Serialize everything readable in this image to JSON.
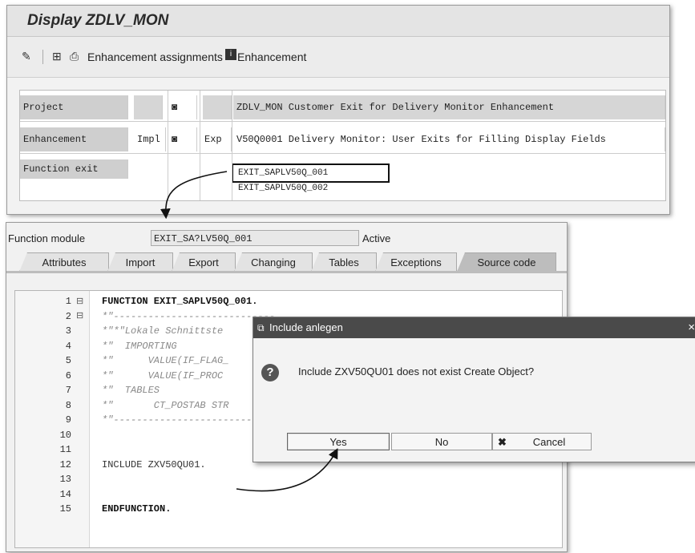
{
  "top_window": {
    "title": "Display ZDLV_MON",
    "toolbar": {
      "enh_assign_label": "Enhancement assignments",
      "enh_label": "Enhancement"
    },
    "rows": [
      {
        "label": "Project",
        "impl": "",
        "exp": "",
        "text": "ZDLV_MON Customer Exit for Delivery Monitor Enhancement"
      },
      {
        "label": "Enhancement",
        "impl": "Impl",
        "exp": "Exp",
        "text": "V50Q0001 Delivery Monitor: User Exits for Filling Display Fields"
      },
      {
        "label": "Function exit",
        "impl": "",
        "exp": "",
        "text": ""
      }
    ],
    "function_exits": [
      "EXIT_SAPLV50Q_001",
      "EXIT_SAPLV50Q_002"
    ]
  },
  "function_module": {
    "label": "Function module",
    "value": "EXIT_SA?LV50Q_001",
    "status": "Active",
    "tabs": [
      "Attributes",
      "Import",
      "Export",
      "Changing",
      "Tables",
      "Exceptions",
      "Source code"
    ],
    "active_tab": "Source code"
  },
  "code_lines": [
    {
      "num": "1",
      "text": "FUNCTION EXIT_SAPLV50Q_001."
    },
    {
      "num": "2",
      "text": "*\"----------------------------"
    },
    {
      "num": "3",
      "text": "*\"*\"Lokale Schnittste"
    },
    {
      "num": "4",
      "text": "*\"  IMPORTING"
    },
    {
      "num": "5",
      "text": "*\"      VALUE(IF_FLAG_"
    },
    {
      "num": "6",
      "text": "*\"      VALUE(IF_PROC"
    },
    {
      "num": "7",
      "text": "*\"  TABLES"
    },
    {
      "num": "8",
      "text": "*\"       CT_POSTAB STR"
    },
    {
      "num": "9",
      "text": "*\"----------------------------"
    },
    {
      "num": "10",
      "text": ""
    },
    {
      "num": "11",
      "text": ""
    },
    {
      "num": "12",
      "text": "INCLUDE ZXV50QU01."
    },
    {
      "num": "13",
      "text": ""
    },
    {
      "num": "14",
      "text": ""
    },
    {
      "num": "15",
      "text": "ENDFUNCTION."
    }
  ],
  "dialog": {
    "title": "Include anlegen",
    "close": "×",
    "message": "Include ZXV50QU01 does not exist Create Object?",
    "yes": "Yes",
    "no": "No",
    "cancel": "Cancel"
  }
}
